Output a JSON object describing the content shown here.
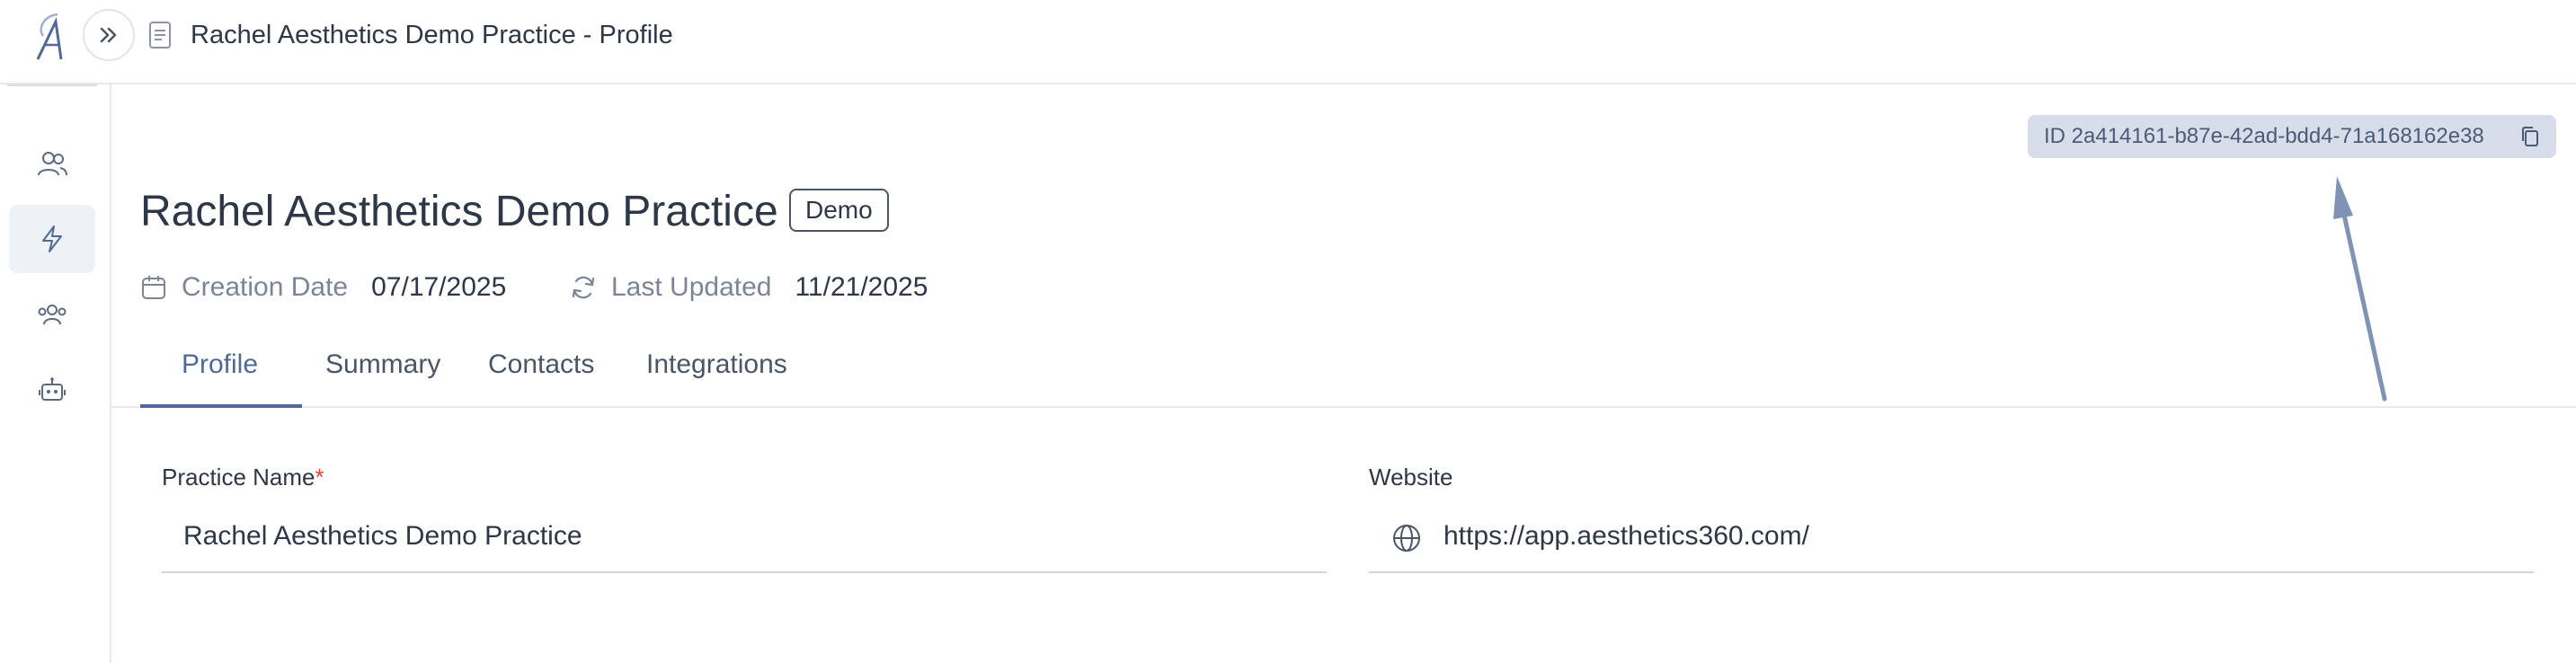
{
  "header": {
    "title": "Rachel Aesthetics Demo Practice - Profile",
    "logo_icon": "aesthetics-a-logo",
    "expand_icon": "chevrons-right-icon",
    "doc_icon": "document-icon"
  },
  "sidebar": {
    "items": [
      {
        "icon": "users-icon",
        "active": false
      },
      {
        "icon": "lightning-icon",
        "active": true
      },
      {
        "icon": "team-icon",
        "active": false
      },
      {
        "icon": "robot-icon",
        "active": false
      }
    ]
  },
  "record": {
    "id_label": "ID 2a414161-b87e-42ad-bdd4-71a168162e38",
    "copy_icon": "copy-icon"
  },
  "practice": {
    "name": "Rachel Aesthetics Demo Practice",
    "badge": "Demo",
    "creation_date_label": "Creation Date",
    "creation_date": "07/17/2025",
    "last_updated_label": "Last Updated",
    "last_updated": "11/21/2025"
  },
  "tabs": [
    {
      "label": "Profile",
      "active": true
    },
    {
      "label": "Summary",
      "active": false
    },
    {
      "label": "Contacts",
      "active": false
    },
    {
      "label": "Integrations",
      "active": false
    }
  ],
  "form": {
    "practice_name_label": "Practice Name",
    "practice_name_required": "*",
    "practice_name_value": "Rachel Aesthetics Demo Practice",
    "website_label": "Website",
    "website_value": "https://app.aesthetics360.com/"
  },
  "colors": {
    "accent": "#4f6a96",
    "pill_bg": "#d7dee9",
    "arrow": "#7f94b4",
    "required": "#e53e3e"
  }
}
